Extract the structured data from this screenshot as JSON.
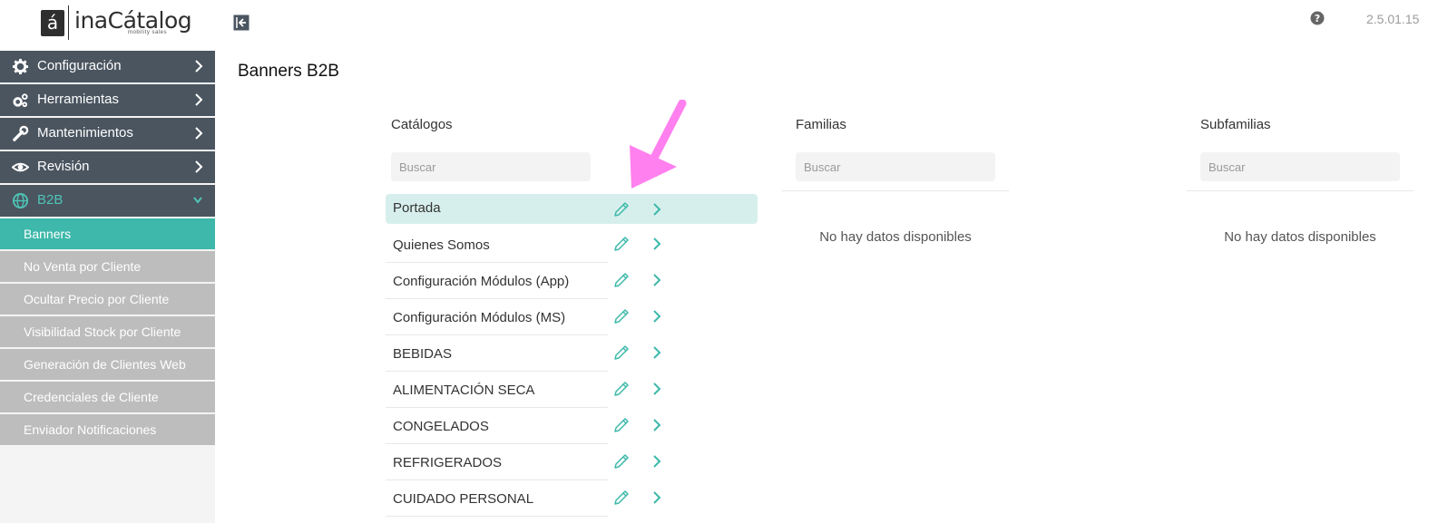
{
  "app": {
    "logo_mark": "á",
    "logo_name": "inaCátalog",
    "logo_tagline": "mobility sales",
    "version": "2.5.01.15"
  },
  "sidebar": {
    "menu": [
      {
        "label": "Configuración",
        "icon": "gear-icon"
      },
      {
        "label": "Herramientas",
        "icon": "gears-icon"
      },
      {
        "label": "Mantenimientos",
        "icon": "wrench-icon"
      },
      {
        "label": "Revisión",
        "icon": "eye-icon"
      },
      {
        "label": "B2B",
        "icon": "globe-icon",
        "expanded": true
      }
    ],
    "submenu": [
      {
        "label": "Banners",
        "active": true
      },
      {
        "label": "No Venta por Cliente"
      },
      {
        "label": "Ocultar Precio por Cliente"
      },
      {
        "label": "Visibilidad Stock por Cliente"
      },
      {
        "label": "Generación de Clientes Web"
      },
      {
        "label": "Credenciales de Cliente"
      },
      {
        "label": "Enviador Notificaciones"
      }
    ]
  },
  "page": {
    "title": "Banners B2B"
  },
  "columns": {
    "catalogos": {
      "title": "Catálogos",
      "search_placeholder": "Buscar",
      "items": [
        {
          "label": "Portada",
          "selected": true
        },
        {
          "label": "Quienes Somos"
        },
        {
          "label": "Configuración Módulos (App)"
        },
        {
          "label": "Configuración Módulos (MS)"
        },
        {
          "label": "BEBIDAS"
        },
        {
          "label": "ALIMENTACIÓN SECA"
        },
        {
          "label": "CONGELADOS"
        },
        {
          "label": "REFRIGERADOS"
        },
        {
          "label": "CUIDADO PERSONAL"
        }
      ]
    },
    "familias": {
      "title": "Familias",
      "search_placeholder": "Buscar",
      "empty": "No hay datos disponibles"
    },
    "subfamilias": {
      "title": "Subfamilias",
      "search_placeholder": "Buscar",
      "empty": "No hay datos disponibles"
    }
  },
  "colors": {
    "sidebar_menu_bg": "#4a5560",
    "accent_teal": "#3db8aa",
    "submenu_bg": "#bdbdbd",
    "selected_row_bg": "#d7efec",
    "annotation_arrow": "#ff80ee"
  }
}
